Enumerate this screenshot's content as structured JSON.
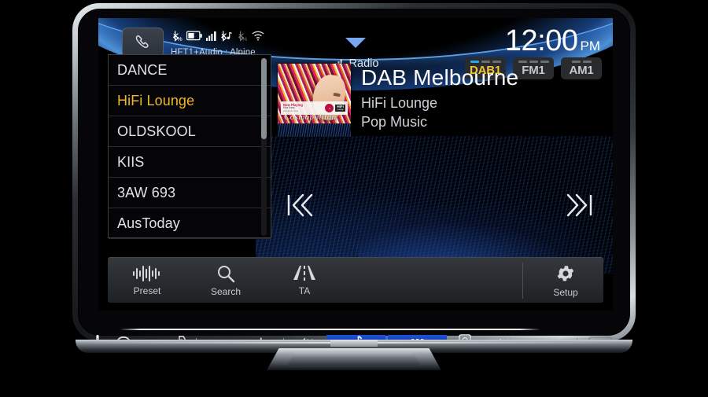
{
  "device": {
    "brand": "ALPINE"
  },
  "status_bar": {
    "phone_button_icon": "phone-handset-icon",
    "icons": [
      {
        "name": "bluetooth-phone-icon"
      },
      {
        "name": "battery-icon"
      },
      {
        "name": "signal-bars-icon"
      },
      {
        "name": "bluetooth-audio-icon"
      },
      {
        "name": "bluetooth-disconnected-icon"
      },
      {
        "name": "wifi-icon"
      }
    ],
    "connection_label": "HFT1+Audio : Alpine",
    "clock_time": "12:00",
    "clock_ampm": "PM"
  },
  "source": {
    "label": "Radio",
    "icon": "signal-bars-icon",
    "dropdown_icon": "chevron-down-icon"
  },
  "bands": [
    {
      "label": "DAB1",
      "active": true
    },
    {
      "label": "FM1",
      "active": false
    },
    {
      "label": "AM1",
      "active": false
    }
  ],
  "station_list": [
    {
      "label": "DANCE",
      "selected": false
    },
    {
      "label": "HiFi Lounge",
      "selected": true
    },
    {
      "label": "OLDSKOOL",
      "selected": false
    },
    {
      "label": "KIIS",
      "selected": false
    },
    {
      "label": "3AW 693",
      "selected": false
    },
    {
      "label": "AusToday",
      "selected": false
    }
  ],
  "now_playing": {
    "title": "DAB Melbourne",
    "subtitle1": "HiFi Lounge",
    "subtitle2": "Pop Music",
    "artwork": {
      "now_playing_label": "Now Playing",
      "track_label": "Kira Kass",
      "track_sub": "Wonderful Soul",
      "brand_logo": "HiFi",
      "brand_logo_sub": "Lounge",
      "magazine_title": "Cosmopolitan"
    }
  },
  "transport": {
    "prev_label": "prev-track",
    "next_label": "next-track"
  },
  "toolbar": [
    {
      "label": "Preset",
      "icon": "waveform-icon"
    },
    {
      "label": "Search",
      "icon": "magnifier-icon"
    },
    {
      "label": "TA",
      "icon": "road-icon"
    },
    {
      "label": "Setup",
      "icon": "gear-icon"
    }
  ],
  "hardware_buttons": [
    {
      "name": "microphone-icon"
    },
    {
      "name": "phone-icon"
    },
    {
      "name": "voice-icon"
    },
    {
      "name": "volume-down-icon",
      "label": "−"
    },
    {
      "name": "volume-up-icon",
      "label": "+"
    },
    {
      "name": "mute-icon"
    },
    {
      "name": "audio-note-icon"
    },
    {
      "name": "apps-grid-icon"
    },
    {
      "name": "camera-icon"
    },
    {
      "name": "prev-track-icon"
    },
    {
      "name": "next-track-icon"
    }
  ],
  "colors": {
    "accent_yellow": "#f0b72c",
    "accent_blue": "#25a7ef",
    "screen_bg": "#000000",
    "text_primary": "#ffffff",
    "text_secondary": "#cfd3d8",
    "hw_blue": "#1c4fd8"
  }
}
